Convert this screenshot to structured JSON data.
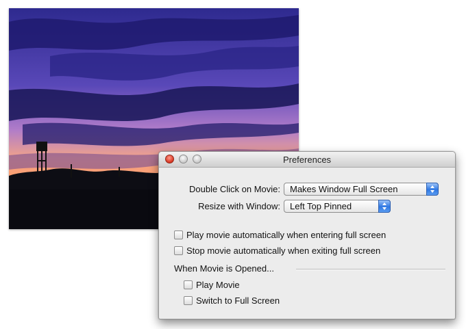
{
  "window": {
    "title": "Preferences"
  },
  "settings": {
    "double_click_label": "Double Click on Movie:",
    "double_click_value": "Makes Window Full Screen",
    "resize_label": "Resize with Window:",
    "resize_value": "Left Top Pinned"
  },
  "checkboxes": {
    "play_on_enter": {
      "label": "Play movie automatically when entering full screen",
      "checked": false
    },
    "stop_on_exit": {
      "label": "Stop movie automatically when exiting full screen",
      "checked": false
    }
  },
  "opened_section": {
    "heading": "When Movie is Opened...",
    "play_movie": {
      "label": "Play Movie",
      "checked": false
    },
    "switch_full_screen": {
      "label": "Switch to Full Screen",
      "checked": false
    }
  },
  "colors": {
    "accent": "#2f78e3",
    "close_button": "#d8331f",
    "window_bg": "#ececec"
  }
}
